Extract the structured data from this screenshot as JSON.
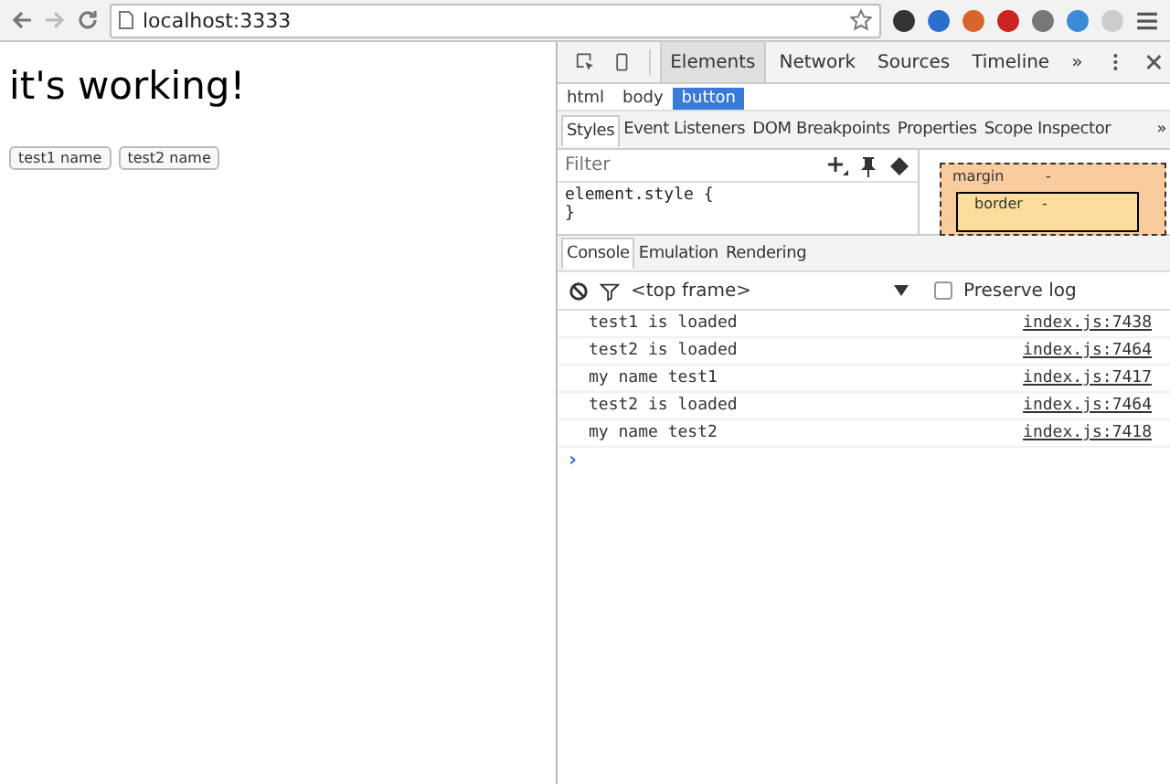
{
  "address_bar": {
    "url": "localhost:3333"
  },
  "page": {
    "heading": "it's working!",
    "buttons": [
      "test1 name",
      "test2 name"
    ]
  },
  "devtools": {
    "tabs": [
      {
        "label": "Elements",
        "selected": true
      },
      {
        "label": "Network",
        "selected": false
      },
      {
        "label": "Sources",
        "selected": false
      },
      {
        "label": "Timeline",
        "selected": false
      }
    ],
    "more": "»",
    "breadcrumbs": [
      {
        "label": "html",
        "selected": false
      },
      {
        "label": "body",
        "selected": false
      },
      {
        "label": "button",
        "selected": true
      }
    ],
    "sidebar_tabs": [
      {
        "label": "Styles",
        "selected": true
      },
      {
        "label": "Event Listeners",
        "selected": false
      },
      {
        "label": "DOM Breakpoints",
        "selected": false
      },
      {
        "label": "Properties",
        "selected": false
      },
      {
        "label": "Scope Inspector",
        "selected": false
      }
    ],
    "filter": {
      "placeholder": "Filter"
    },
    "styles_code": [
      "element.style {",
      "}"
    ],
    "box_model": {
      "margin_label": "margin",
      "margin_value": "-",
      "border_label": "border",
      "border_value": "-"
    },
    "drawer_tabs": [
      {
        "label": "Console",
        "selected": true
      },
      {
        "label": "Emulation",
        "selected": false
      },
      {
        "label": "Rendering",
        "selected": false
      }
    ],
    "context": "<top frame>",
    "preserve_log": {
      "label": "Preserve log",
      "checked": false
    },
    "logs": [
      {
        "message": "test1 is loaded",
        "source": "index.js:7438"
      },
      {
        "message": "test2 is loaded",
        "source": "index.js:7464"
      },
      {
        "message": "my name test1",
        "source": "index.js:7417"
      },
      {
        "message": "test2 is loaded",
        "source": "index.js:7464"
      },
      {
        "message": "my name test2",
        "source": "index.js:7418"
      }
    ],
    "prompt": "›"
  }
}
